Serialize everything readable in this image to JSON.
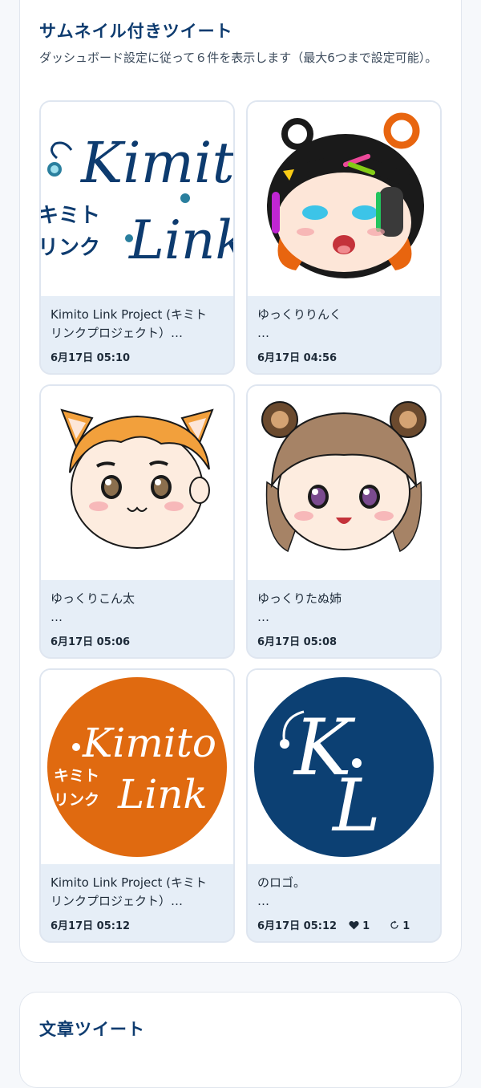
{
  "thumb_section": {
    "title": "サムネイル付きツイート",
    "description": "ダッシュボード設定に従って６件を表示します（最大6つまで設定可能）。"
  },
  "cards": [
    {
      "line1": "Kimito Link Project (キミト",
      "line2": "リンクプロジェクト）…",
      "date": "6月17日 05:10",
      "thumb": "kimito-link-logo-text-image"
    },
    {
      "line1": "ゆっくりりんく",
      "line2": "…",
      "date": "6月17日 04:56",
      "thumb": "yukkuri-rinku-character-image"
    },
    {
      "line1": "ゆっくりこん太",
      "line2": "…",
      "date": "6月17日 05:06",
      "thumb": "yukkuri-konta-character-image"
    },
    {
      "line1": "ゆっくりたぬ姉",
      "line2": "…",
      "date": "6月17日 05:08",
      "thumb": "yukkuri-tanunee-character-image"
    },
    {
      "line1": "Kimito Link Project (キミト",
      "line2": "リンクプロジェクト）…",
      "date": "6月17日 05:12",
      "thumb": "kimito-link-orange-circle-logo"
    },
    {
      "line1": "のロゴ。",
      "line2": "…",
      "date": "6月17日 05:12",
      "likes": "1",
      "retweets": "1",
      "thumb": "kl-blue-circle-logo"
    }
  ],
  "logo_text": {
    "kimito": "Kimito",
    "link": "Link",
    "kimito_kana": "キミト",
    "link_kana": "リンク",
    "kl_k": "K",
    "kl_l": "L"
  },
  "icons": {
    "like": "heart-icon",
    "retweet": "retweet-icon"
  },
  "text_section": {
    "title": "文章ツイート"
  },
  "colors": {
    "accent": "#0d3b6f",
    "card_bg": "#e6eef7",
    "orange": "#e06a10",
    "navy": "#0c4073"
  }
}
